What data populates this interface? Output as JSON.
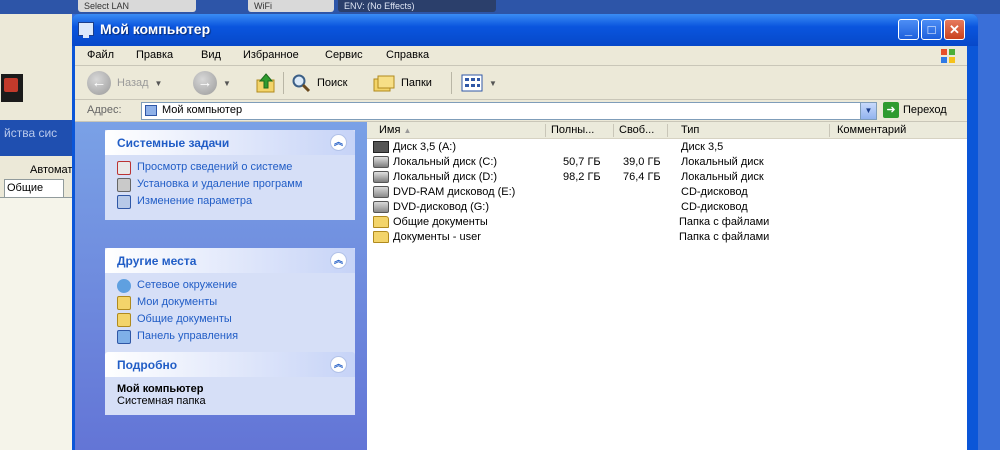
{
  "window": {
    "title": "Мой компьютер"
  },
  "background": {
    "taskbar_items": [
      "Select LAN",
      "WiFi",
      "ENV: (No Effects)"
    ],
    "side_title": "йства сис",
    "tab_auto": "Автомат",
    "tab_general": "Общие"
  },
  "menu": [
    "Файл",
    "Правка",
    "Вид",
    "Избранное",
    "Сервис",
    "Справка"
  ],
  "toolbar": {
    "back": "Назад",
    "search": "Поиск",
    "folders": "Папки"
  },
  "address": {
    "label": "Адрес:",
    "value": "Мой компьютер",
    "go": "Переход"
  },
  "system_tasks": {
    "title": "Системные задачи",
    "items": [
      "Просмотр сведений о системе",
      "Установка и удаление программ",
      "Изменение параметра"
    ]
  },
  "other_places": {
    "title": "Другие места",
    "items": [
      "Сетевое окружение",
      "Мои документы",
      "Общие документы",
      "Панель управления"
    ]
  },
  "details": {
    "title": "Подробно",
    "name": "Мой компьютер",
    "subtitle": "Системная папка"
  },
  "columns": {
    "name": "Имя",
    "total": "Полны...",
    "free": "Своб...",
    "type": "Тип",
    "comment": "Комментарий"
  },
  "items": [
    {
      "icon": "floppy-drive-icon",
      "name": "Диск 3,5 (A:)",
      "total": "",
      "free": "",
      "type": "Диск 3,5"
    },
    {
      "icon": "hard-drive-icon",
      "name": "Локальный диск (C:)",
      "total": "50,7 ГБ",
      "free": "39,0 ГБ",
      "type": "Локальный диск"
    },
    {
      "icon": "hard-drive-icon",
      "name": "Локальный диск (D:)",
      "total": "98,2 ГБ",
      "free": "76,4 ГБ",
      "type": "Локальный диск"
    },
    {
      "icon": "dvd-drive-icon",
      "name": "DVD-RAM дисковод (E:)",
      "total": "",
      "free": "",
      "type": "CD-дисковод"
    },
    {
      "icon": "dvd-drive-icon",
      "name": "DVD-дисковод (G:)",
      "total": "",
      "free": "",
      "type": "CD-дисковод"
    },
    {
      "icon": "folder-icon",
      "name": "Общие документы",
      "total": "",
      "free": "",
      "type": "Папка с файлами"
    },
    {
      "icon": "folder-icon",
      "name": "Документы - user",
      "total": "",
      "free": "",
      "type": "Папка с файлами"
    }
  ]
}
